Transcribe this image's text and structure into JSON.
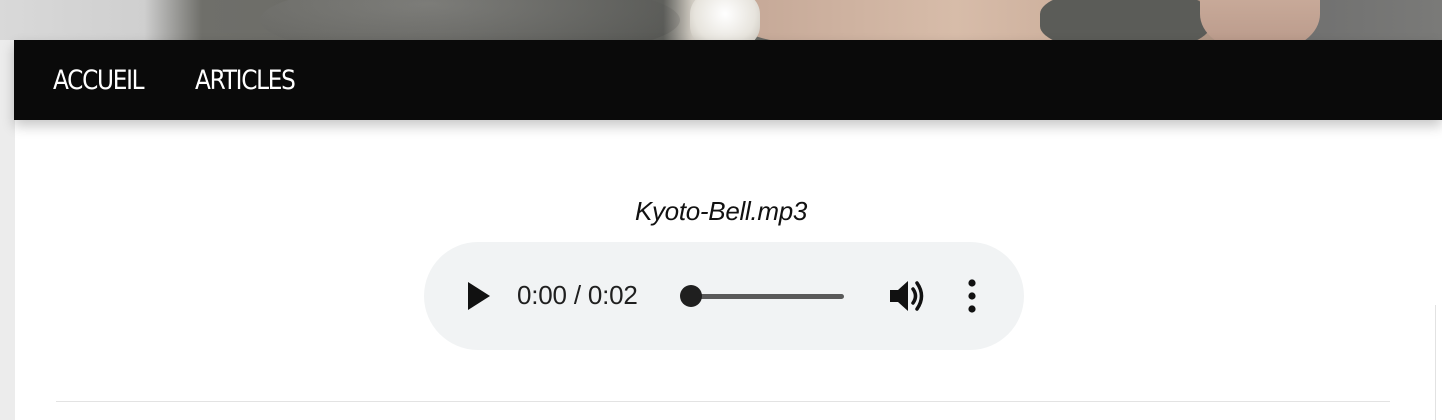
{
  "nav": {
    "items": [
      {
        "label": "ACCUEIL"
      },
      {
        "label": "ARTICLES"
      }
    ]
  },
  "content": {
    "audio_caption": "Kyoto-Bell.mp3"
  },
  "audio_player": {
    "time_display": "0:00 / 0:02",
    "progress_fraction": 0,
    "icons": {
      "play": "play-icon",
      "volume": "volume-icon",
      "menu": "more-vertical-icon"
    }
  }
}
